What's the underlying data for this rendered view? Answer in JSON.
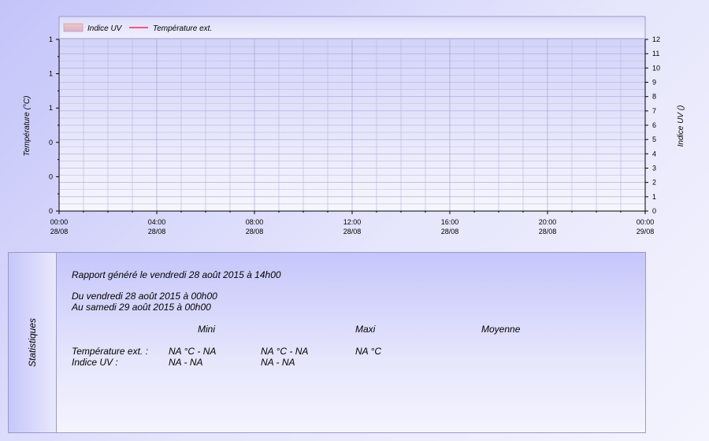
{
  "chart_data": {
    "type": "line",
    "legend": {
      "placement": "top-left",
      "entries": [
        {
          "name": "Indice UV",
          "kind": "area",
          "color": "#e8b8c0"
        },
        {
          "name": "Température ext.",
          "kind": "line",
          "color": "#ff0033"
        }
      ]
    },
    "y_left": {
      "label": "Température (°C)",
      "ticks": [
        "1",
        "1",
        "1",
        "0",
        "0",
        "0"
      ]
    },
    "y_right": {
      "label": "Indice UV ()",
      "ylim": [
        0,
        12
      ],
      "ticks": [
        0,
        1,
        2,
        3,
        4,
        5,
        6,
        7,
        8,
        9,
        10,
        11,
        12
      ]
    },
    "x": {
      "ticks": [
        {
          "time": "00:00",
          "date": "28/08"
        },
        {
          "time": "04:00",
          "date": "28/08"
        },
        {
          "time": "08:00",
          "date": "28/08"
        },
        {
          "time": "12:00",
          "date": "28/08"
        },
        {
          "time": "16:00",
          "date": "28/08"
        },
        {
          "time": "20:00",
          "date": "28/08"
        },
        {
          "time": "00:00",
          "date": "29/08"
        }
      ]
    },
    "grid": true,
    "series": [
      {
        "name": "Indice UV",
        "values": []
      },
      {
        "name": "Température ext.",
        "values": []
      }
    ]
  },
  "stats": {
    "side_title": "Statistiques",
    "report": "Rapport généré le vendredi 28 août 2015 à 14h00",
    "from": "Du vendredi 28 août 2015 à 00h00",
    "to": "Au samedi 29 août 2015 à 00h00",
    "headers": {
      "min": "Mini",
      "max": "Maxi",
      "avg": "Moyenne"
    },
    "rows": [
      {
        "label": "Température ext. :",
        "min": "NA °C - NA",
        "max": "NA °C - NA",
        "avg": "NA °C"
      },
      {
        "label": "Indice UV :",
        "min": "NA - NA",
        "max": "NA - NA",
        "avg": ""
      }
    ]
  }
}
